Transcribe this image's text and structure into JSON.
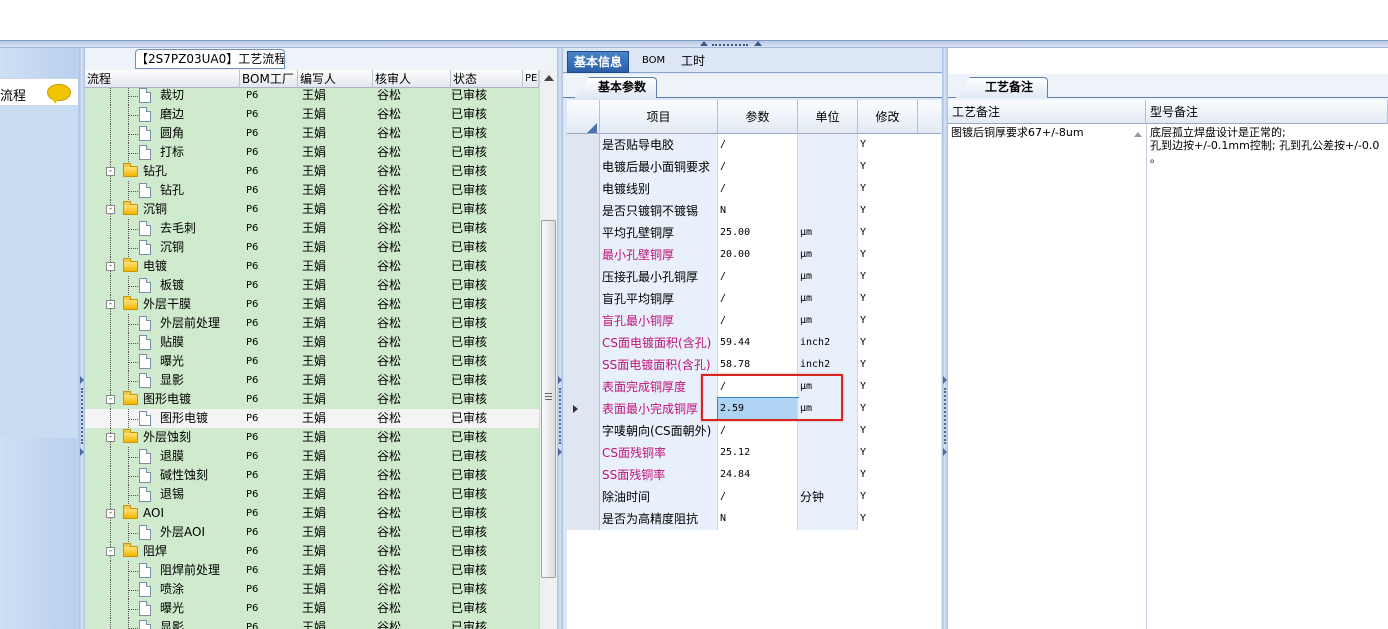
{
  "left_nav": {
    "item_label": "流程"
  },
  "flow_panel": {
    "title": "【2S7PZ03UA0】工艺流程",
    "headers": [
      "流程",
      "BOM工厂",
      "编写人",
      "核审人",
      "状态",
      "PE"
    ],
    "rows": [
      {
        "name": "裁切",
        "level": 1,
        "type": "doc",
        "bom": "P6",
        "writer": "王娟",
        "reviewer": "谷松",
        "status": "已审核"
      },
      {
        "name": "磨边",
        "level": 1,
        "type": "doc",
        "bom": "P6",
        "writer": "王娟",
        "reviewer": "谷松",
        "status": "已审核"
      },
      {
        "name": "圆角",
        "level": 1,
        "type": "doc",
        "bom": "P6",
        "writer": "王娟",
        "reviewer": "谷松",
        "status": "已审核"
      },
      {
        "name": "打标",
        "level": 1,
        "type": "doc",
        "bom": "P6",
        "writer": "王娟",
        "reviewer": "谷松",
        "status": "已审核"
      },
      {
        "name": "钻孔",
        "level": 0,
        "type": "folder",
        "bom": "P6",
        "writer": "王娟",
        "reviewer": "谷松",
        "status": "已审核"
      },
      {
        "name": "钻孔",
        "level": 1,
        "type": "doc",
        "bom": "P6",
        "writer": "王娟",
        "reviewer": "谷松",
        "status": "已审核"
      },
      {
        "name": "沉铜",
        "level": 0,
        "type": "folder",
        "bom": "P6",
        "writer": "王娟",
        "reviewer": "谷松",
        "status": "已审核"
      },
      {
        "name": "去毛刺",
        "level": 1,
        "type": "doc",
        "bom": "P6",
        "writer": "王娟",
        "reviewer": "谷松",
        "status": "已审核"
      },
      {
        "name": "沉铜",
        "level": 1,
        "type": "doc",
        "bom": "P6",
        "writer": "王娟",
        "reviewer": "谷松",
        "status": "已审核"
      },
      {
        "name": "电镀",
        "level": 0,
        "type": "folder",
        "bom": "P6",
        "writer": "王娟",
        "reviewer": "谷松",
        "status": "已审核"
      },
      {
        "name": "板镀",
        "level": 1,
        "type": "doc",
        "bom": "P6",
        "writer": "王娟",
        "reviewer": "谷松",
        "status": "已审核"
      },
      {
        "name": "外层干膜",
        "level": 0,
        "type": "folder",
        "bom": "P6",
        "writer": "王娟",
        "reviewer": "谷松",
        "status": "已审核"
      },
      {
        "name": "外层前处理",
        "level": 1,
        "type": "doc",
        "bom": "P6",
        "writer": "王娟",
        "reviewer": "谷松",
        "status": "已审核"
      },
      {
        "name": "贴膜",
        "level": 1,
        "type": "doc",
        "bom": "P6",
        "writer": "王娟",
        "reviewer": "谷松",
        "status": "已审核"
      },
      {
        "name": "曝光",
        "level": 1,
        "type": "doc",
        "bom": "P6",
        "writer": "王娟",
        "reviewer": "谷松",
        "status": "已审核"
      },
      {
        "name": "显影",
        "level": 1,
        "type": "doc",
        "bom": "P6",
        "writer": "王娟",
        "reviewer": "谷松",
        "status": "已审核"
      },
      {
        "name": "图形电镀",
        "level": 0,
        "type": "folder",
        "bom": "P6",
        "writer": "王娟",
        "reviewer": "谷松",
        "status": "已审核"
      },
      {
        "name": "图形电镀",
        "level": 1,
        "type": "doc",
        "bom": "P6",
        "writer": "王娟",
        "reviewer": "谷松",
        "status": "已审核",
        "selected": true
      },
      {
        "name": "外层蚀刻",
        "level": 0,
        "type": "folder",
        "bom": "P6",
        "writer": "王娟",
        "reviewer": "谷松",
        "status": "已审核"
      },
      {
        "name": "退膜",
        "level": 1,
        "type": "doc",
        "bom": "P6",
        "writer": "王娟",
        "reviewer": "谷松",
        "status": "已审核"
      },
      {
        "name": "碱性蚀刻",
        "level": 1,
        "type": "doc",
        "bom": "P6",
        "writer": "王娟",
        "reviewer": "谷松",
        "status": "已审核"
      },
      {
        "name": "退锡",
        "level": 1,
        "type": "doc",
        "bom": "P6",
        "writer": "王娟",
        "reviewer": "谷松",
        "status": "已审核"
      },
      {
        "name": "AOI",
        "level": 0,
        "type": "folder",
        "bom": "P6",
        "writer": "王娟",
        "reviewer": "谷松",
        "status": "已审核"
      },
      {
        "name": "外层AOI",
        "level": 1,
        "type": "doc",
        "bom": "P6",
        "writer": "王娟",
        "reviewer": "谷松",
        "status": "已审核"
      },
      {
        "name": "阻焊",
        "level": 0,
        "type": "folder",
        "bom": "P6",
        "writer": "王娟",
        "reviewer": "谷松",
        "status": "已审核"
      },
      {
        "name": "阻焊前处理",
        "level": 1,
        "type": "doc",
        "bom": "P6",
        "writer": "王娟",
        "reviewer": "谷松",
        "status": "已审核"
      },
      {
        "name": "喷涂",
        "level": 1,
        "type": "doc",
        "bom": "P6",
        "writer": "王娟",
        "reviewer": "谷松",
        "status": "已审核"
      },
      {
        "name": "曝光",
        "level": 1,
        "type": "doc",
        "bom": "P6",
        "writer": "王娟",
        "reviewer": "谷松",
        "status": "已审核"
      },
      {
        "name": "显影",
        "level": 1,
        "type": "doc",
        "bom": "P6",
        "writer": "王娟",
        "reviewer": "谷松",
        "status": "已审核"
      }
    ]
  },
  "mid_panel": {
    "tabs": [
      "基本信息",
      "BOM",
      "工时"
    ],
    "sub_tab": "基本参数",
    "headers": [
      "项目",
      "参数",
      "单位",
      "修改"
    ],
    "rows": [
      {
        "item": "是否贴导电胶",
        "param": "/",
        "unit": "",
        "mod": "Y",
        "red": false
      },
      {
        "item": "电镀后最小面铜要求",
        "param": "/",
        "unit": "",
        "mod": "Y",
        "red": false
      },
      {
        "item": "电镀线别",
        "param": "/",
        "unit": "",
        "mod": "Y",
        "red": false
      },
      {
        "item": "是否只镀铜不镀锡",
        "param": "N",
        "unit": "",
        "mod": "Y",
        "red": false
      },
      {
        "item": "平均孔壁铜厚",
        "param": "25.00",
        "unit": "μm",
        "mod": "Y",
        "red": false
      },
      {
        "item": "最小孔壁铜厚",
        "param": "20.00",
        "unit": "μm",
        "mod": "Y",
        "red": true
      },
      {
        "item": "压接孔最小孔铜厚",
        "param": "/",
        "unit": "μm",
        "mod": "Y",
        "red": false
      },
      {
        "item": "盲孔平均铜厚",
        "param": "/",
        "unit": "μm",
        "mod": "Y",
        "red": false
      },
      {
        "item": "盲孔最小铜厚",
        "param": "/",
        "unit": "μm",
        "mod": "Y",
        "red": true
      },
      {
        "item": "CS面电镀面积(含孔)",
        "param": "59.44",
        "unit": "inch2",
        "mod": "Y",
        "red": true
      },
      {
        "item": "SS面电镀面积(含孔)",
        "param": "58.78",
        "unit": "inch2",
        "mod": "Y",
        "red": true
      },
      {
        "item": "表面完成铜厚度",
        "param": "/",
        "unit": "μm",
        "mod": "Y",
        "red": true
      },
      {
        "item": "表面最小完成铜厚",
        "param": "2.59",
        "unit": "μm",
        "mod": "Y",
        "red": true,
        "current": true
      },
      {
        "item": "字唛朝向(CS面朝外)",
        "param": "/",
        "unit": "",
        "mod": "Y",
        "red": false
      },
      {
        "item": "CS面残铜率",
        "param": "25.12",
        "unit": "",
        "mod": "Y",
        "red": true
      },
      {
        "item": "SS面残铜率",
        "param": "24.84",
        "unit": "",
        "mod": "Y",
        "red": true
      },
      {
        "item": "除油时间",
        "param": "/",
        "unit": "分钟",
        "mod": "Y",
        "red": false
      },
      {
        "item": "是否为高精度阻抗",
        "param": "N",
        "unit": "",
        "mod": "Y",
        "red": false
      }
    ]
  },
  "right_panel": {
    "tab": "工艺备注",
    "headers": [
      "工艺备注",
      "型号备注"
    ],
    "process_note": "图镀后铜厚要求67+/-8um",
    "model_note": "底层孤立焊盘设计是正常的;\n孔到边按+/-0.1mm控制; 孔到孔公差按+/-0.0\n。"
  },
  "colors": {
    "accent": "#2a5fa8",
    "tree_bg": "#cfeacd",
    "red_text": "#c0127a",
    "highlight": "#d8241f"
  },
  "icons": [
    "speech-bubble-icon",
    "folder-icon",
    "document-icon",
    "expander-icon"
  ]
}
